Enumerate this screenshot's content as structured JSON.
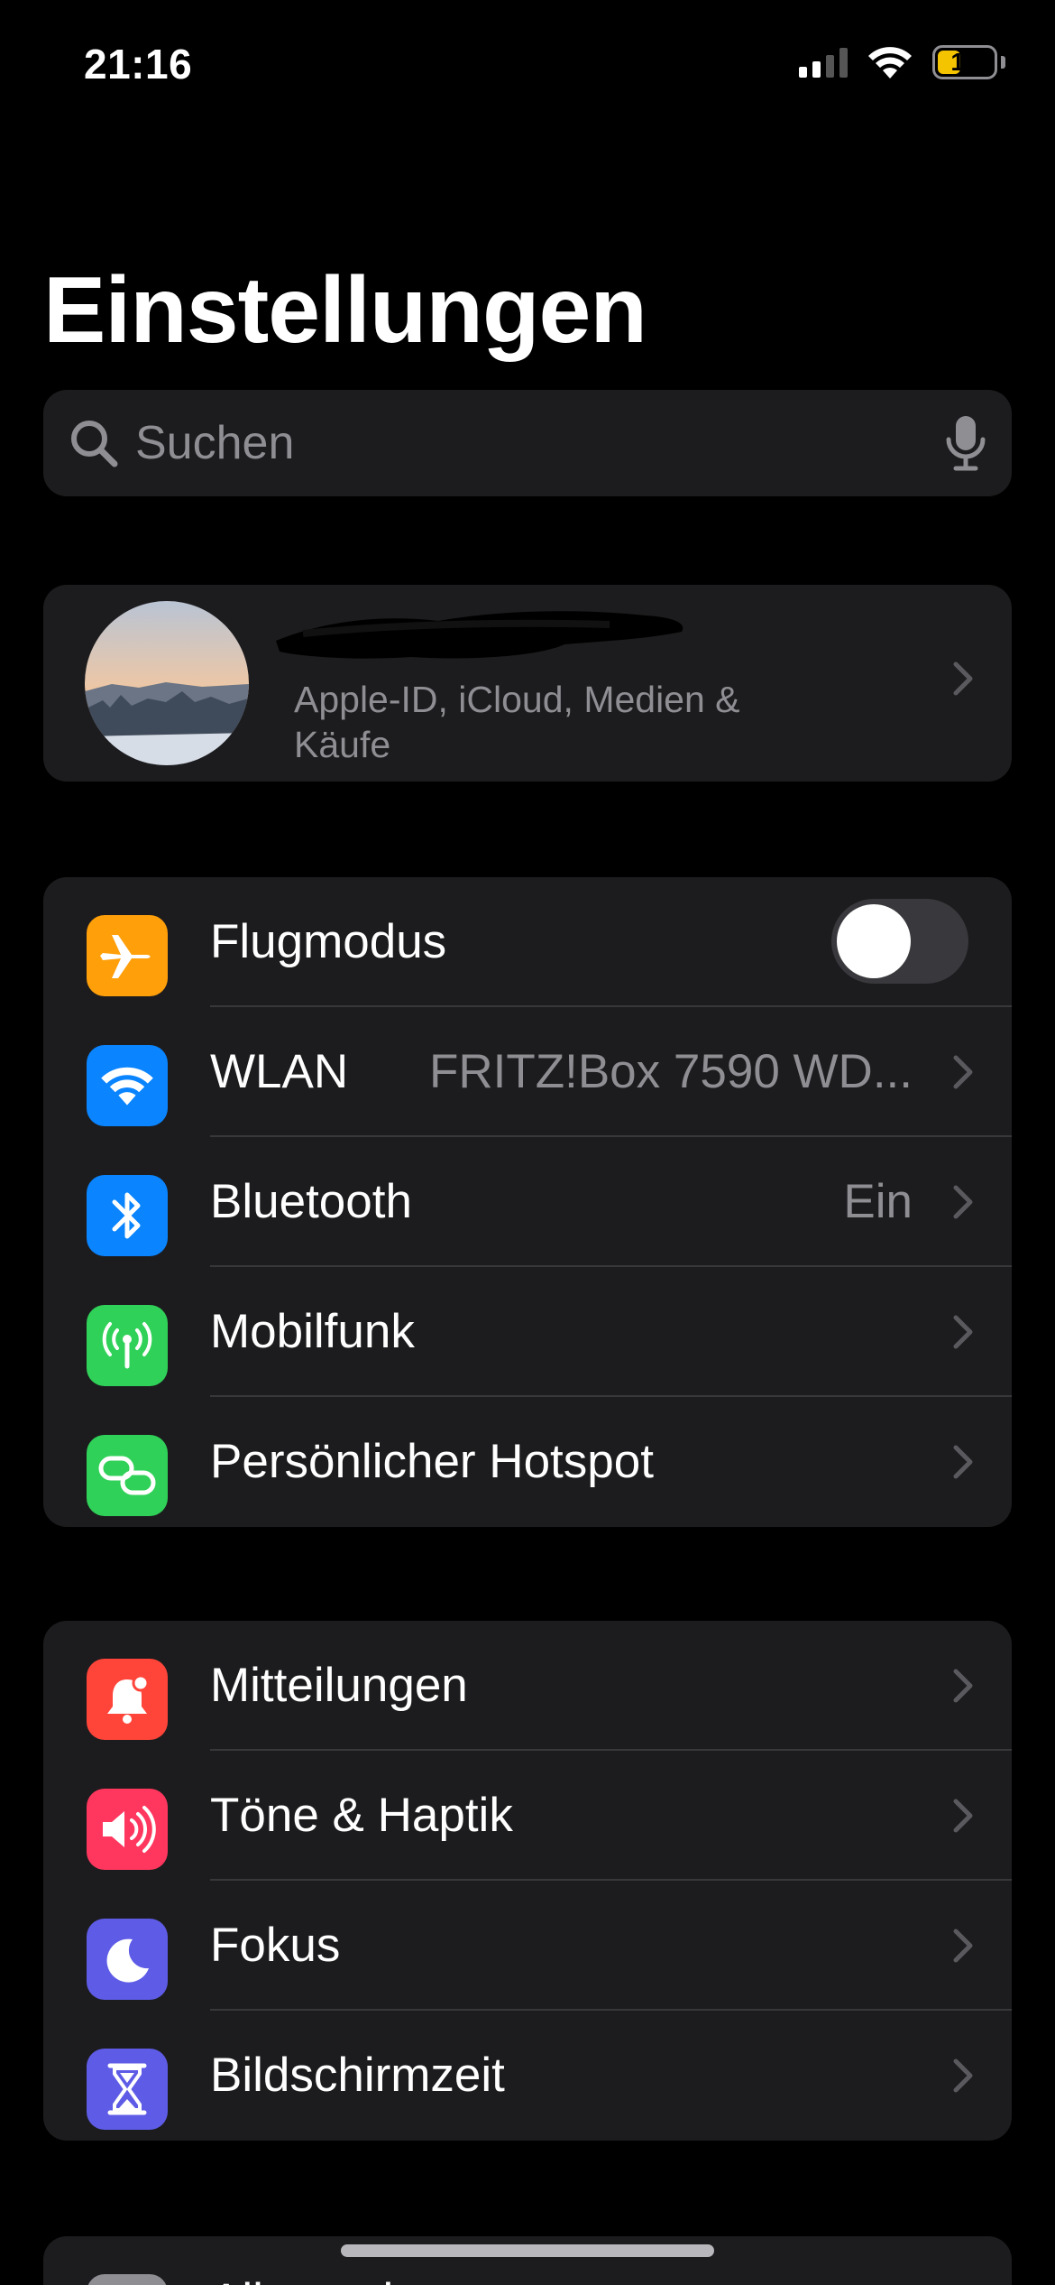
{
  "status": {
    "time": "21:16",
    "battery": "19"
  },
  "title": "Einstellungen",
  "search": {
    "placeholder": "Suchen"
  },
  "profile": {
    "subtitle": "Apple-ID, iCloud, Medien & Käufe"
  },
  "connectivity": [
    {
      "label": "Flugmodus",
      "icon": "airplane-icon",
      "color": "#ff9f0a"
    },
    {
      "label": "WLAN",
      "value": "FRITZ!Box 7590 WD...",
      "icon": "wifi-icon",
      "color": "#0a84ff"
    },
    {
      "label": "Bluetooth",
      "value": "Ein",
      "icon": "bluetooth-icon",
      "color": "#0a84ff"
    },
    {
      "label": "Mobilfunk",
      "icon": "antenna-icon",
      "color": "#30d158"
    },
    {
      "label": "Persönlicher Hotspot",
      "icon": "hotspot-icon",
      "color": "#30d158"
    }
  ],
  "notifications": [
    {
      "label": "Mitteilungen",
      "icon": "bell-icon",
      "color": "#ff453a"
    },
    {
      "label": "Töne & Haptik",
      "icon": "speaker-icon",
      "color": "#ff375f"
    },
    {
      "label": "Fokus",
      "icon": "moon-icon",
      "color": "#5e5ce6"
    },
    {
      "label": "Bildschirmzeit",
      "icon": "hourglass-icon",
      "color": "#5e5ce6"
    }
  ],
  "general": [
    {
      "label": "Allgemein",
      "icon": "gear-icon",
      "color": "#8e8e93"
    }
  ]
}
